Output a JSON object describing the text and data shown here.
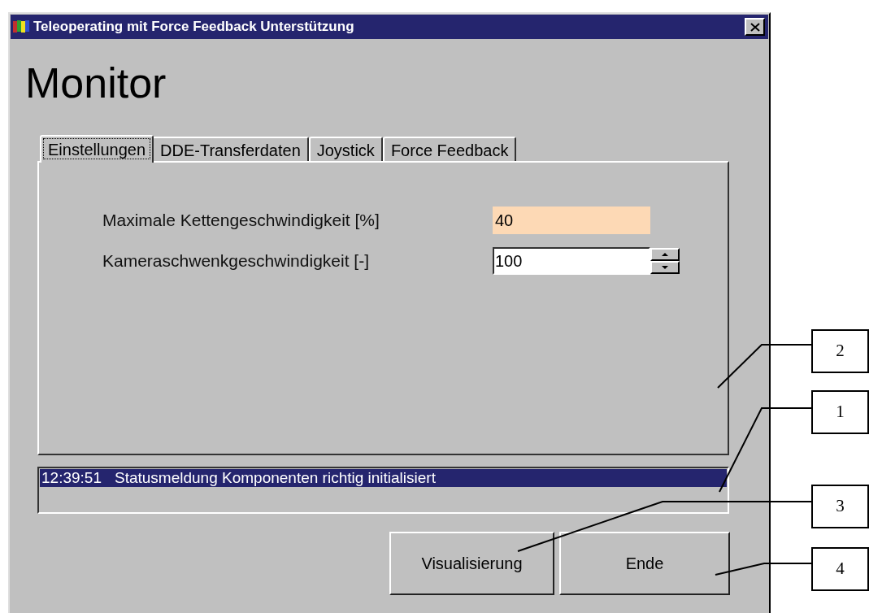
{
  "window": {
    "title": "Teleoperating mit Force Feedback Unterstützung"
  },
  "heading": "Monitor",
  "tabs": [
    {
      "label": "Einstellungen",
      "selected": true
    },
    {
      "label": "DDE-Transferdaten",
      "selected": false
    },
    {
      "label": "Joystick",
      "selected": false
    },
    {
      "label": "Force Feedback",
      "selected": false
    }
  ],
  "fields": [
    {
      "kind": "text",
      "label": "Maximale Kettengeschwindigkeit [%]",
      "value": "40",
      "highlighted": true
    },
    {
      "kind": "spinner",
      "label": "Kameraschwenkgeschwindigkeit [-]",
      "value": "100",
      "highlighted": false
    }
  ],
  "status_list": [
    {
      "time": "12:39:51",
      "message": "Statusmeldung Komponenten richtig initialisiert",
      "selected": true
    }
  ],
  "buttons": [
    "Visualisierung",
    "Ende"
  ],
  "callouts": [
    "2",
    "1",
    "3",
    "4"
  ]
}
